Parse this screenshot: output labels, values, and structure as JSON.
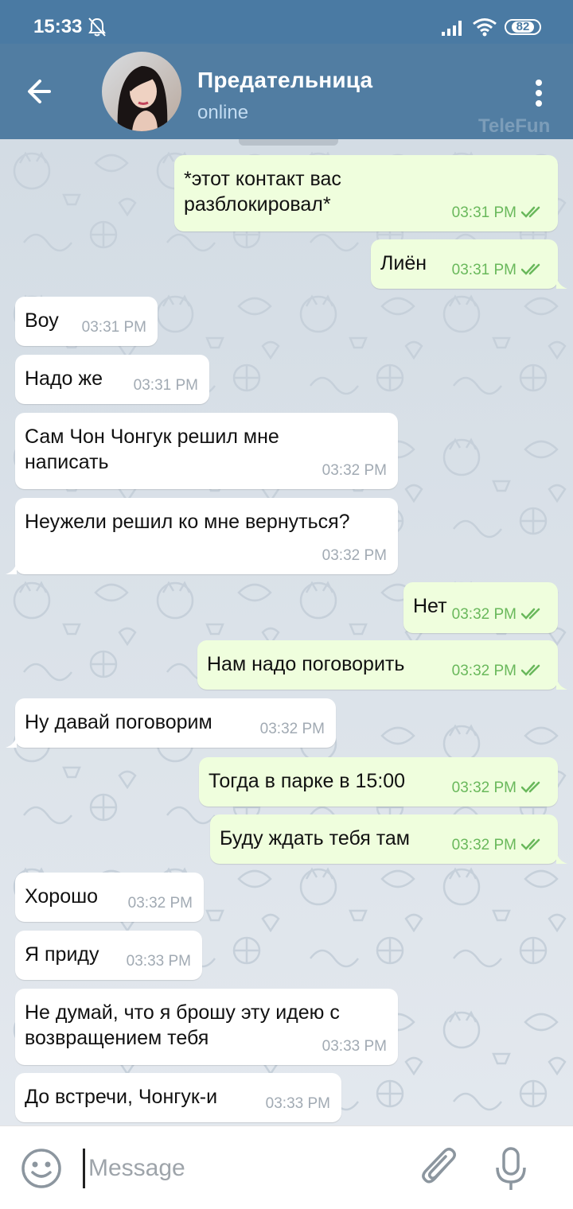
{
  "status_bar": {
    "time": "15:33",
    "battery": "82"
  },
  "header": {
    "back_icon": "arrow-left-icon",
    "title": "Предательница",
    "status": "online",
    "menu_icon": "more-vertical-icon",
    "watermark": "TeleFun"
  },
  "colors": {
    "header": "#517da2",
    "status_bar": "#4a7aa3",
    "incoming_bubble": "#ffffff",
    "outgoing_bubble": "#effedd",
    "read_check": "#69b85b"
  },
  "messages": [
    {
      "direction": "out",
      "text": "*этот контакт вас разблокировал*",
      "time": "03:31 PM"
    },
    {
      "direction": "out",
      "text": "Лиён",
      "time": "03:31 PM"
    },
    {
      "direction": "in",
      "text": "Воу",
      "time": "03:31 PM"
    },
    {
      "direction": "in",
      "text": "Надо же",
      "time": "03:31 PM"
    },
    {
      "direction": "in",
      "text": "Сам Чон Чонгук решил мне написать",
      "time": "03:32 PM"
    },
    {
      "direction": "in",
      "text": "Неужели решил ко мне вернуться?",
      "time": "03:32 PM"
    },
    {
      "direction": "out",
      "text": "Нет",
      "time": "03:32 PM"
    },
    {
      "direction": "out",
      "text": "Нам надо поговорить",
      "time": "03:32 PM"
    },
    {
      "direction": "in",
      "text": "Ну давай поговорим",
      "time": "03:32 PM"
    },
    {
      "direction": "out",
      "text": "Тогда в парке в 15:00",
      "time": "03:32 PM"
    },
    {
      "direction": "out",
      "text": "Буду ждать тебя там",
      "time": "03:32 PM"
    },
    {
      "direction": "in",
      "text": "Хорошо",
      "time": "03:32 PM"
    },
    {
      "direction": "in",
      "text": "Я приду",
      "time": "03:33 PM"
    },
    {
      "direction": "in",
      "text": "Не думай, что я брошу эту идею с возвращением тебя",
      "time": "03:33 PM"
    },
    {
      "direction": "in",
      "text": "До встречи, Чонгук-и",
      "time": "03:33 PM"
    }
  ],
  "composer": {
    "placeholder": "Message",
    "emoji_icon": "emoji-icon",
    "attach_icon": "paperclip-icon",
    "mic_icon": "microphone-icon"
  }
}
